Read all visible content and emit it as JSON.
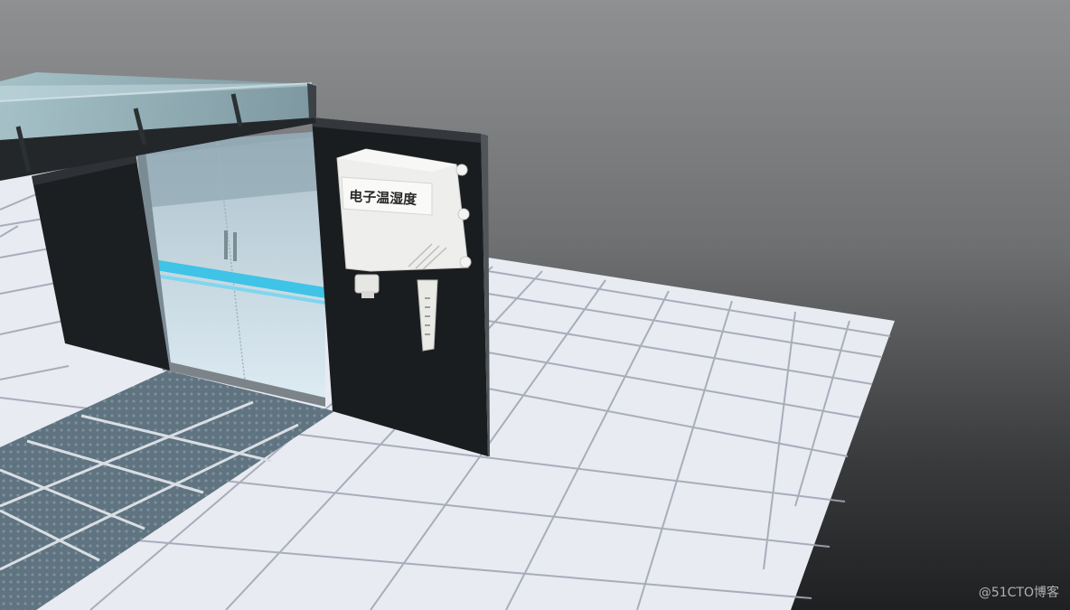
{
  "sensor": {
    "label": "电子温湿度"
  },
  "watermark": {
    "text": "@51CTO博客"
  },
  "colors": {
    "background_top": "#8f9092",
    "background_bottom": "#1f2022",
    "floor_tile": "#e9ecf2",
    "floor_grid": "#a8abb8",
    "wall_panel": "#1b1e21",
    "glass": "#b8d4e0",
    "accent_stripe": "#3fc3e6",
    "sensor_body": "#eeeeec"
  }
}
